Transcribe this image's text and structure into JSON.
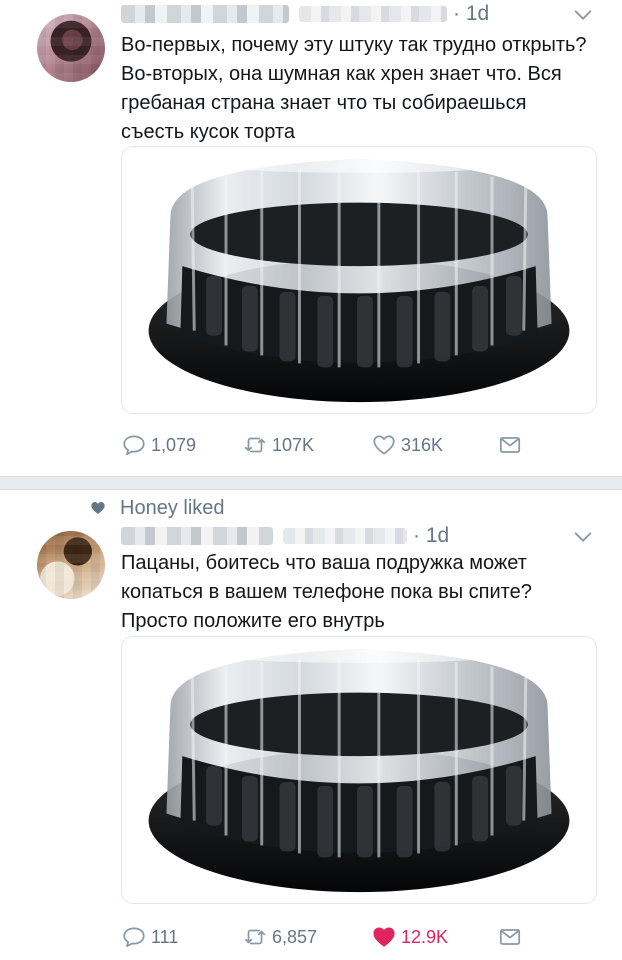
{
  "tweets": [
    {
      "time": "· 1d",
      "text": "Во-первых, почему эту штуку так трудно открыть? Во-вторых, она шумная как хрен знает что. Вся гребаная страна знает что ты собираешься съесть кусок торта",
      "reply_count": "1,079",
      "retweet_count": "107K",
      "like_count": "316K",
      "liked": false
    },
    {
      "context": "Honey liked",
      "time": "· 1d",
      "text": "Пацаны, боитесь что ваша подружка может копаться в вашем телефоне пока вы спите? Просто положите его внутрь",
      "reply_count": "111",
      "retweet_count": "6,857",
      "like_count": "12.9K",
      "liked": true
    }
  ],
  "icons": {
    "reply": "reply-icon",
    "retweet": "retweet-icon",
    "like": "heart-icon",
    "dm": "direct-message-icon",
    "menu": "chevron-down-icon"
  },
  "colors": {
    "text": "#14171a",
    "secondary": "#657786",
    "like_active": "#e0245e",
    "separator": "#e6ecf0"
  }
}
